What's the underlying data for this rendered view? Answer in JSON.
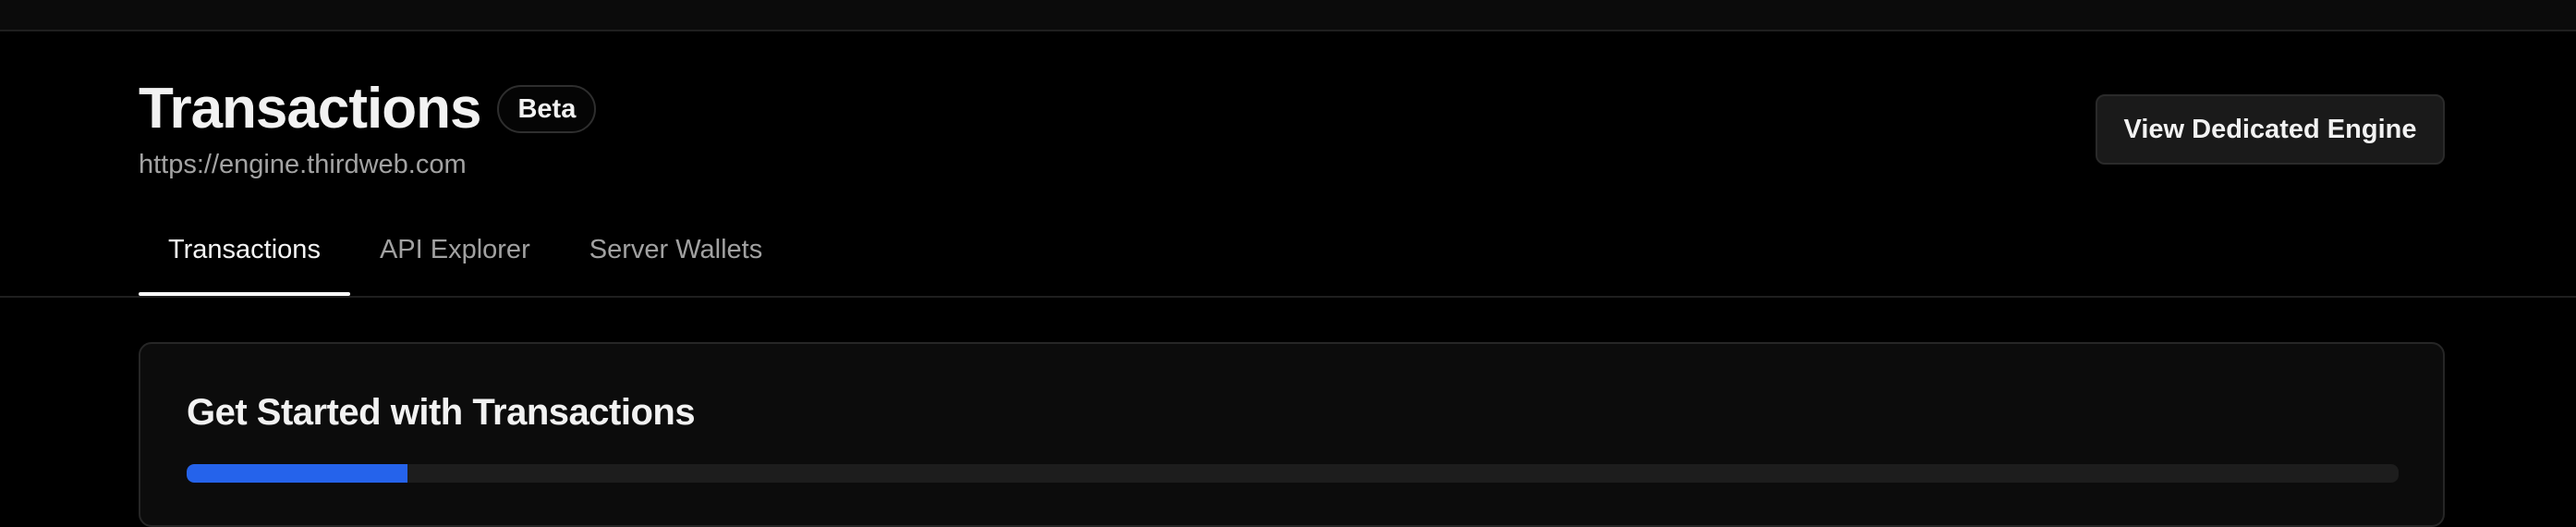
{
  "header": {
    "title": "Transactions",
    "badge": "Beta",
    "url": "https://engine.thirdweb.com",
    "action_label": "View Dedicated Engine"
  },
  "tabs": [
    {
      "label": "Transactions",
      "active": true
    },
    {
      "label": "API Explorer",
      "active": false
    },
    {
      "label": "Server Wallets",
      "active": false
    }
  ],
  "getting_started": {
    "title": "Get Started with Transactions",
    "progress_percent": 10
  },
  "colors": {
    "background": "#000000",
    "accent": "#2563eb"
  }
}
